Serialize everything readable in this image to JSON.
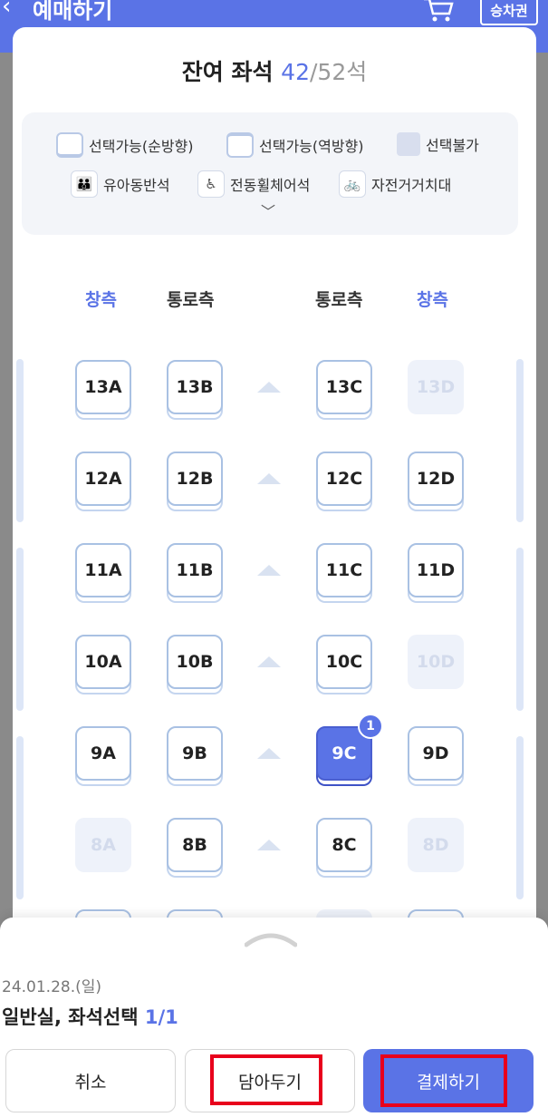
{
  "header": {
    "title": "예매하기",
    "ticket_label": "승차권",
    "bg_color": "#5a73e6"
  },
  "summary": {
    "prefix": "잔여 좌석 ",
    "available": "42",
    "total": "/52석"
  },
  "legend": {
    "forward": "선택가능(순방향)",
    "reverse": "선택가능(역방향)",
    "unavailable": "선택불가",
    "family": "유아동반석",
    "wheelchair": "전동휠체어석",
    "bicycle": "자전거거치대"
  },
  "columns": {
    "left_window": "창측",
    "left_aisle": "통로측",
    "right_aisle": "통로측",
    "right_window": "창측"
  },
  "seats": [
    {
      "id": "13A",
      "state": "available"
    },
    {
      "id": "13B",
      "state": "available"
    },
    {
      "id": "13C",
      "state": "available"
    },
    {
      "id": "13D",
      "state": "unavailable"
    },
    {
      "id": "12A",
      "state": "available"
    },
    {
      "id": "12B",
      "state": "available"
    },
    {
      "id": "12C",
      "state": "available"
    },
    {
      "id": "12D",
      "state": "available"
    },
    {
      "id": "11A",
      "state": "available"
    },
    {
      "id": "11B",
      "state": "available"
    },
    {
      "id": "11C",
      "state": "available"
    },
    {
      "id": "11D",
      "state": "available"
    },
    {
      "id": "10A",
      "state": "available"
    },
    {
      "id": "10B",
      "state": "available"
    },
    {
      "id": "10C",
      "state": "available"
    },
    {
      "id": "10D",
      "state": "unavailable"
    },
    {
      "id": "9A",
      "state": "available"
    },
    {
      "id": "9B",
      "state": "available"
    },
    {
      "id": "9C",
      "state": "selected"
    },
    {
      "id": "9D",
      "state": "available"
    },
    {
      "id": "8A",
      "state": "unavailable"
    },
    {
      "id": "8B",
      "state": "available"
    },
    {
      "id": "8C",
      "state": "available"
    },
    {
      "id": "8D",
      "state": "unavailable"
    }
  ],
  "selected_badge": "1",
  "bottom": {
    "date": "24.01.28.(일)",
    "class_label": "일반실, 좌석선택 ",
    "class_count": "1/1",
    "cancel": "취소",
    "save": "담아두기",
    "pay": "결제하기"
  },
  "accent_color": "#5a73e6",
  "highlight_color": "#e8001c"
}
